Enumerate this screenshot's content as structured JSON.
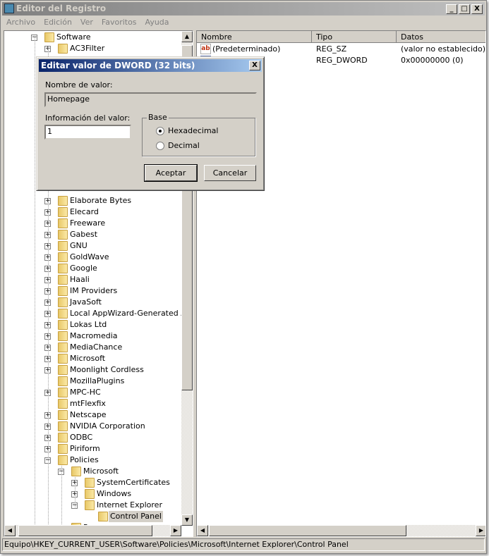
{
  "window": {
    "title": "Editor del Registro",
    "buttons": {
      "minimize": "_",
      "maximize": "□",
      "close": "X"
    }
  },
  "menu": [
    "Archivo",
    "Edición",
    "Ver",
    "Favoritos",
    "Ayuda"
  ],
  "tree": {
    "top": [
      {
        "label": "Software",
        "level": 0,
        "expander": "minus"
      },
      {
        "label": "AC3Filter",
        "level": 1,
        "expander": "plus"
      }
    ],
    "items": [
      {
        "label": "Elaborate Bytes",
        "level": 1,
        "expander": "plus"
      },
      {
        "label": "Elecard",
        "level": 1,
        "expander": "plus"
      },
      {
        "label": "Freeware",
        "level": 1,
        "expander": "plus"
      },
      {
        "label": "Gabest",
        "level": 1,
        "expander": "plus"
      },
      {
        "label": "GNU",
        "level": 1,
        "expander": "plus"
      },
      {
        "label": "GoldWave",
        "level": 1,
        "expander": "plus"
      },
      {
        "label": "Google",
        "level": 1,
        "expander": "plus"
      },
      {
        "label": "Haali",
        "level": 1,
        "expander": "plus"
      },
      {
        "label": "IM Providers",
        "level": 1,
        "expander": "plus"
      },
      {
        "label": "JavaSoft",
        "level": 1,
        "expander": "plus"
      },
      {
        "label": "Local AppWizard-Generated App",
        "level": 1,
        "expander": "plus"
      },
      {
        "label": "Lokas Ltd",
        "level": 1,
        "expander": "plus"
      },
      {
        "label": "Macromedia",
        "level": 1,
        "expander": "plus"
      },
      {
        "label": "MediaChance",
        "level": 1,
        "expander": "plus"
      },
      {
        "label": "Microsoft",
        "level": 1,
        "expander": "plus"
      },
      {
        "label": "Moonlight Cordless",
        "level": 1,
        "expander": "plus"
      },
      {
        "label": "MozillaPlugins",
        "level": 1,
        "expander": "none"
      },
      {
        "label": "MPC-HC",
        "level": 1,
        "expander": "plus"
      },
      {
        "label": "mtFlexfix",
        "level": 1,
        "expander": "none"
      },
      {
        "label": "Netscape",
        "level": 1,
        "expander": "plus"
      },
      {
        "label": "NVIDIA Corporation",
        "level": 1,
        "expander": "plus"
      },
      {
        "label": "ODBC",
        "level": 1,
        "expander": "plus"
      },
      {
        "label": "Piriform",
        "level": 1,
        "expander": "plus"
      },
      {
        "label": "Policies",
        "level": 1,
        "expander": "minus"
      },
      {
        "label": "Microsoft",
        "level": 2,
        "expander": "minus"
      },
      {
        "label": "SystemCertificates",
        "level": 3,
        "expander": "plus"
      },
      {
        "label": "Windows",
        "level": 3,
        "expander": "plus"
      },
      {
        "label": "Internet Explorer",
        "level": 3,
        "expander": "minus"
      },
      {
        "label": "Control Panel",
        "level": 4,
        "expander": "none",
        "selected": true
      },
      {
        "label": "Power",
        "level": 2,
        "expander": "plus"
      }
    ]
  },
  "list": {
    "columns": [
      "Nombre",
      "Tipo",
      "Datos"
    ],
    "rows": [
      {
        "name": "(Predeterminado)",
        "type": "REG_SZ",
        "data": "(valor no establecido)",
        "icon": "string-value-icon"
      },
      {
        "name": "",
        "type": "REG_DWORD",
        "data": "0x00000000 (0)",
        "icon": "binary-value-icon"
      }
    ]
  },
  "status": "Equipo\\HKEY_CURRENT_USER\\Software\\Policies\\Microsoft\\Internet Explorer\\Control Panel",
  "dialog": {
    "title": "Editar valor de DWORD (32 bits)",
    "close": "X",
    "name_label": "Nombre de valor:",
    "name_value": "Homepage",
    "data_label": "Información del valor:",
    "data_value": "1",
    "base_label": "Base",
    "base_options": [
      "Hexadecimal",
      "Decimal"
    ],
    "base_selected": "Hexadecimal",
    "ok": "Aceptar",
    "cancel": "Cancelar"
  },
  "colors": {
    "dialog_title_start": "#0a246a",
    "dialog_title_end": "#a6caf0",
    "face": "#d4d0c8"
  }
}
